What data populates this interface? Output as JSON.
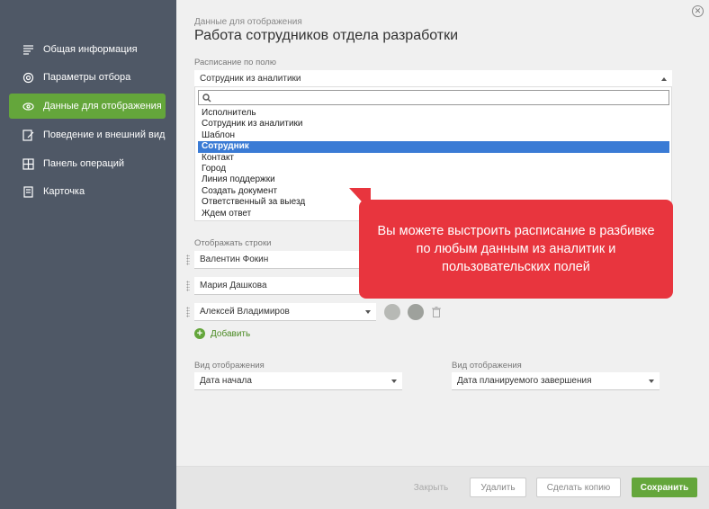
{
  "sidebar": {
    "items": [
      {
        "label": "Общая информация",
        "icon": "list-icon"
      },
      {
        "label": "Параметры отбора",
        "icon": "gear-icon"
      },
      {
        "label": "Данные для отображения",
        "icon": "eye-icon"
      },
      {
        "label": "Поведение и внешний вид",
        "icon": "edit-icon"
      },
      {
        "label": "Панель операций",
        "icon": "grid-icon"
      },
      {
        "label": "Карточка",
        "icon": "card-icon"
      }
    ],
    "active_index": 2
  },
  "header": {
    "subtitle": "Данные для отображения",
    "title": "Работа сотрудников отдела разработки"
  },
  "schedule": {
    "label": "Расписание по полю",
    "value": "Сотрудник из аналитики",
    "search_value": "",
    "options": [
      "Исполнитель",
      "Сотрудник из аналитики",
      "Шаблон",
      "Сотрудник",
      "Контакт",
      "Город",
      "Линия поддержки",
      "Создать документ",
      "Ответственный за выезд",
      "Ждем ответ"
    ],
    "selected_option": "Сотрудник"
  },
  "rows": {
    "label": "Отображать строки",
    "items": [
      "Валентин Фокин",
      "Мария Дашкова",
      "Алексей Владимиров"
    ],
    "add_label": "Добавить"
  },
  "view_start": {
    "label": "Вид отображения",
    "value": "Дата начала"
  },
  "view_end": {
    "label": "Вид отображения",
    "value": "Дата планируемого завершения"
  },
  "callout": {
    "text": "Вы можете выстроить расписание в разбивке по любым данным из аналитик и пользовательских полей"
  },
  "footer": {
    "close_label": "Закрыть",
    "delete_label": "Удалить",
    "copy_label": "Сделать копию",
    "save_label": "Сохранить"
  },
  "colors": {
    "accent": "#64a63b",
    "sidebar": "#4f5866",
    "callout": "#e8353e",
    "selected": "#3a7bd5"
  }
}
